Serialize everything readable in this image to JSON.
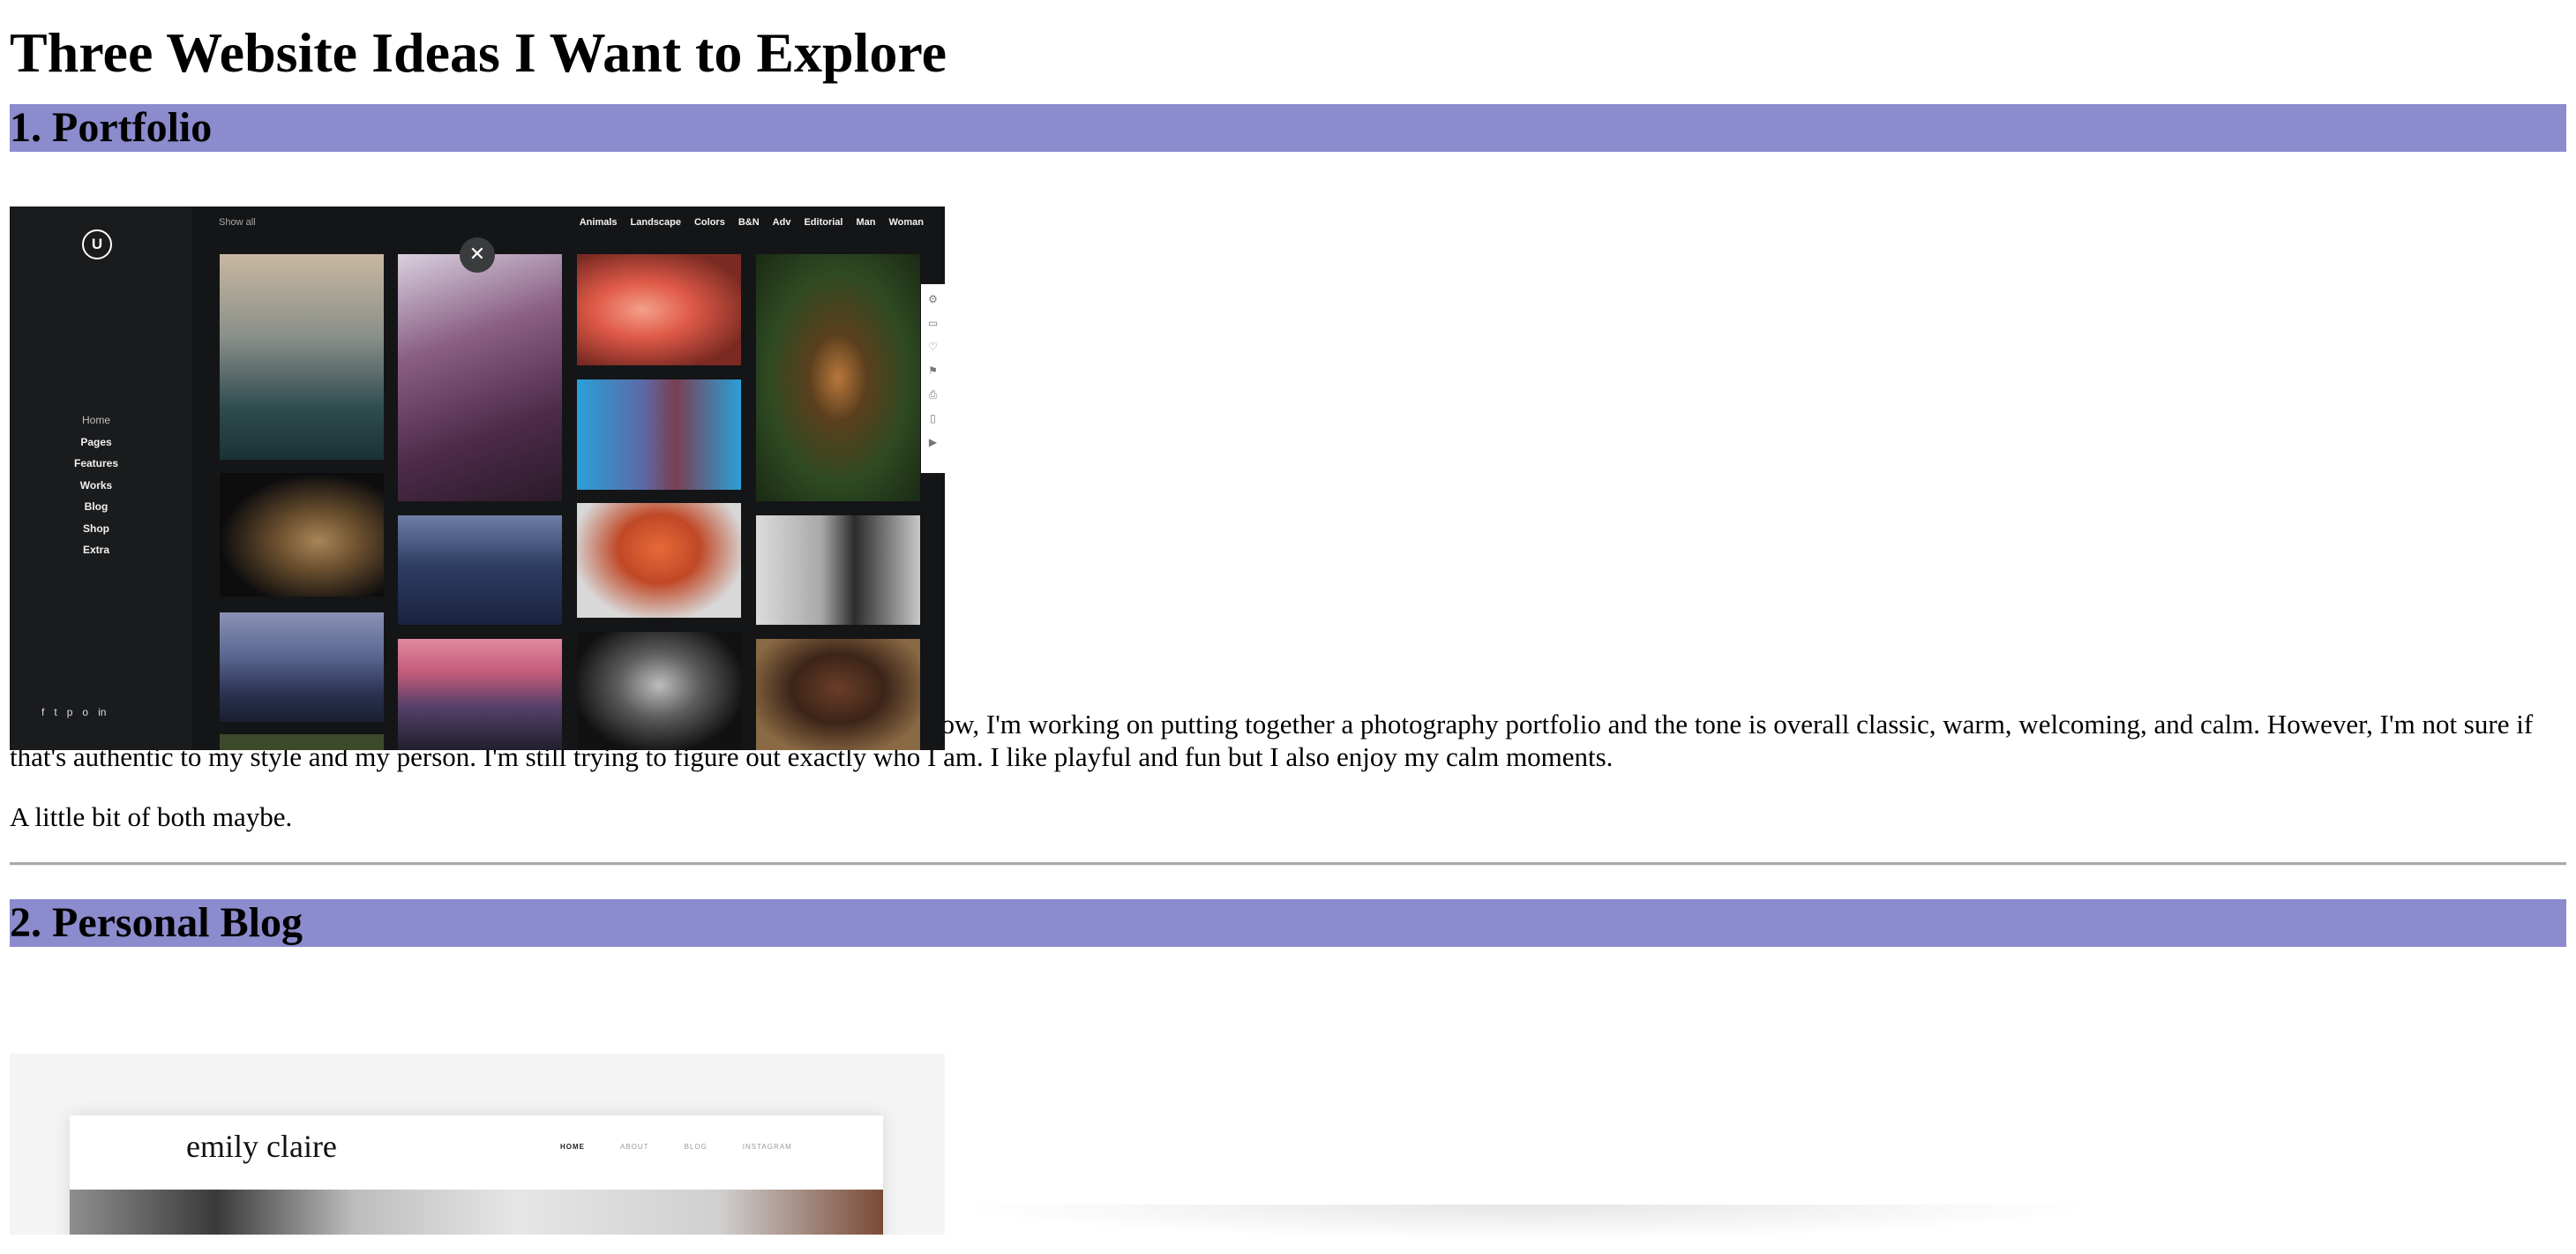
{
  "page": {
    "title": "Three Website Ideas I Want to Explore"
  },
  "sections": [
    {
      "heading": "1. Portfolio",
      "paragraphs": [
        "For my portfolio website I would want the tone to be playful as well as calm. Right now, I'm working on putting together a photography portfolio and the tone is overall classic, warm, welcoming, and calm. However, I'm not sure if that's authentic to my style and my person. I'm still trying to figure out exactly who I am. I like playful and fun but I also enjoy my calm moments.",
        "A little bit of both maybe."
      ]
    },
    {
      "heading": "2. Personal Blog"
    }
  ],
  "portfolio_mock": {
    "logo_letter": "U",
    "nav": [
      "Home",
      "Pages",
      "Features",
      "Works",
      "Blog",
      "Shop",
      "Extra"
    ],
    "show_all": "Show all",
    "categories": [
      "Animals",
      "Landscape",
      "Colors",
      "B&N",
      "Adv",
      "Editorial",
      "Man",
      "Woman"
    ],
    "social_icons": [
      "f",
      "t",
      "p",
      "o",
      "in"
    ],
    "close_glyph": "✕",
    "toolbar_icons": [
      "⚙",
      "▭",
      "♡",
      "⚑",
      "⎙",
      "▯",
      "▶"
    ]
  },
  "blog_mock": {
    "brand": "emily claire",
    "nav": [
      "HOME",
      "ABOUT",
      "BLOG",
      "INSTAGRAM"
    ]
  }
}
